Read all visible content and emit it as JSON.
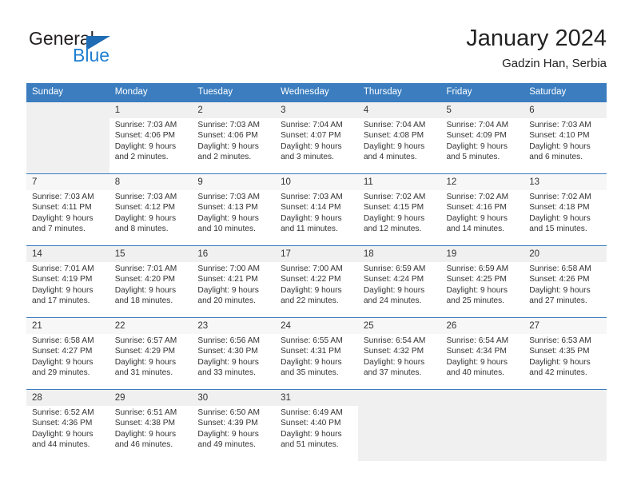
{
  "brand": {
    "name_part1": "General",
    "name_part2": "Blue",
    "logo_icon": "blue-triangle-flag",
    "color_dark": "#231f20",
    "color_blue": "#1f7fd0"
  },
  "header": {
    "title": "January 2024",
    "subtitle": "Gadzin Han, Serbia"
  },
  "theme": {
    "header_blue": "#3b7dbf",
    "row_shade": "#f0f0f0",
    "text": "#333333"
  },
  "weekdays": [
    "Sunday",
    "Monday",
    "Tuesday",
    "Wednesday",
    "Thursday",
    "Friday",
    "Saturday"
  ],
  "weeks": [
    {
      "shaded": true,
      "days": [
        {
          "num": "",
          "details": ""
        },
        {
          "num": "1",
          "details": "Sunrise: 7:03 AM\nSunset: 4:06 PM\nDaylight: 9 hours\nand 2 minutes."
        },
        {
          "num": "2",
          "details": "Sunrise: 7:03 AM\nSunset: 4:06 PM\nDaylight: 9 hours\nand 2 minutes."
        },
        {
          "num": "3",
          "details": "Sunrise: 7:04 AM\nSunset: 4:07 PM\nDaylight: 9 hours\nand 3 minutes."
        },
        {
          "num": "4",
          "details": "Sunrise: 7:04 AM\nSunset: 4:08 PM\nDaylight: 9 hours\nand 4 minutes."
        },
        {
          "num": "5",
          "details": "Sunrise: 7:04 AM\nSunset: 4:09 PM\nDaylight: 9 hours\nand 5 minutes."
        },
        {
          "num": "6",
          "details": "Sunrise: 7:03 AM\nSunset: 4:10 PM\nDaylight: 9 hours\nand 6 minutes."
        }
      ]
    },
    {
      "shaded": false,
      "days": [
        {
          "num": "7",
          "details": "Sunrise: 7:03 AM\nSunset: 4:11 PM\nDaylight: 9 hours\nand 7 minutes."
        },
        {
          "num": "8",
          "details": "Sunrise: 7:03 AM\nSunset: 4:12 PM\nDaylight: 9 hours\nand 8 minutes."
        },
        {
          "num": "9",
          "details": "Sunrise: 7:03 AM\nSunset: 4:13 PM\nDaylight: 9 hours\nand 10 minutes."
        },
        {
          "num": "10",
          "details": "Sunrise: 7:03 AM\nSunset: 4:14 PM\nDaylight: 9 hours\nand 11 minutes."
        },
        {
          "num": "11",
          "details": "Sunrise: 7:02 AM\nSunset: 4:15 PM\nDaylight: 9 hours\nand 12 minutes."
        },
        {
          "num": "12",
          "details": "Sunrise: 7:02 AM\nSunset: 4:16 PM\nDaylight: 9 hours\nand 14 minutes."
        },
        {
          "num": "13",
          "details": "Sunrise: 7:02 AM\nSunset: 4:18 PM\nDaylight: 9 hours\nand 15 minutes."
        }
      ]
    },
    {
      "shaded": true,
      "days": [
        {
          "num": "14",
          "details": "Sunrise: 7:01 AM\nSunset: 4:19 PM\nDaylight: 9 hours\nand 17 minutes."
        },
        {
          "num": "15",
          "details": "Sunrise: 7:01 AM\nSunset: 4:20 PM\nDaylight: 9 hours\nand 18 minutes."
        },
        {
          "num": "16",
          "details": "Sunrise: 7:00 AM\nSunset: 4:21 PM\nDaylight: 9 hours\nand 20 minutes."
        },
        {
          "num": "17",
          "details": "Sunrise: 7:00 AM\nSunset: 4:22 PM\nDaylight: 9 hours\nand 22 minutes."
        },
        {
          "num": "18",
          "details": "Sunrise: 6:59 AM\nSunset: 4:24 PM\nDaylight: 9 hours\nand 24 minutes."
        },
        {
          "num": "19",
          "details": "Sunrise: 6:59 AM\nSunset: 4:25 PM\nDaylight: 9 hours\nand 25 minutes."
        },
        {
          "num": "20",
          "details": "Sunrise: 6:58 AM\nSunset: 4:26 PM\nDaylight: 9 hours\nand 27 minutes."
        }
      ]
    },
    {
      "shaded": false,
      "days": [
        {
          "num": "21",
          "details": "Sunrise: 6:58 AM\nSunset: 4:27 PM\nDaylight: 9 hours\nand 29 minutes."
        },
        {
          "num": "22",
          "details": "Sunrise: 6:57 AM\nSunset: 4:29 PM\nDaylight: 9 hours\nand 31 minutes."
        },
        {
          "num": "23",
          "details": "Sunrise: 6:56 AM\nSunset: 4:30 PM\nDaylight: 9 hours\nand 33 minutes."
        },
        {
          "num": "24",
          "details": "Sunrise: 6:55 AM\nSunset: 4:31 PM\nDaylight: 9 hours\nand 35 minutes."
        },
        {
          "num": "25",
          "details": "Sunrise: 6:54 AM\nSunset: 4:32 PM\nDaylight: 9 hours\nand 37 minutes."
        },
        {
          "num": "26",
          "details": "Sunrise: 6:54 AM\nSunset: 4:34 PM\nDaylight: 9 hours\nand 40 minutes."
        },
        {
          "num": "27",
          "details": "Sunrise: 6:53 AM\nSunset: 4:35 PM\nDaylight: 9 hours\nand 42 minutes."
        }
      ]
    },
    {
      "shaded": true,
      "days": [
        {
          "num": "28",
          "details": "Sunrise: 6:52 AM\nSunset: 4:36 PM\nDaylight: 9 hours\nand 44 minutes."
        },
        {
          "num": "29",
          "details": "Sunrise: 6:51 AM\nSunset: 4:38 PM\nDaylight: 9 hours\nand 46 minutes."
        },
        {
          "num": "30",
          "details": "Sunrise: 6:50 AM\nSunset: 4:39 PM\nDaylight: 9 hours\nand 49 minutes."
        },
        {
          "num": "31",
          "details": "Sunrise: 6:49 AM\nSunset: 4:40 PM\nDaylight: 9 hours\nand 51 minutes."
        },
        {
          "num": "",
          "details": ""
        },
        {
          "num": "",
          "details": ""
        },
        {
          "num": "",
          "details": ""
        }
      ]
    }
  ]
}
